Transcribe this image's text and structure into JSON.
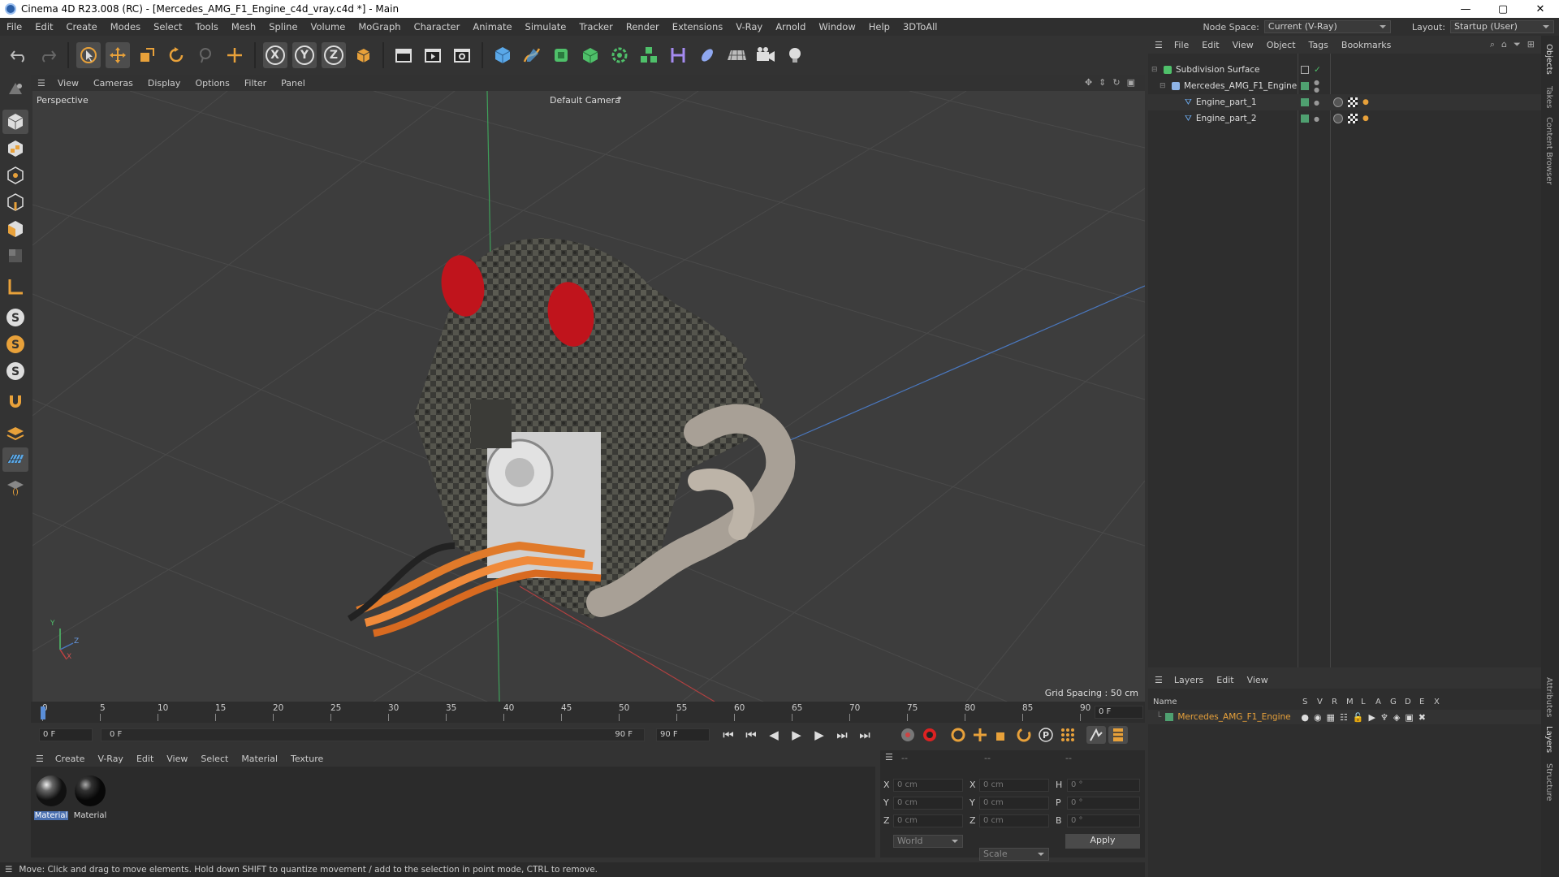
{
  "title": "Cinema 4D R23.008 (RC) - [Mercedes_AMG_F1_Engine_c4d_vray.c4d *] - Main",
  "window_buttons": [
    "—",
    "▢",
    "✕"
  ],
  "menu": [
    "File",
    "Edit",
    "Create",
    "Modes",
    "Select",
    "Tools",
    "Mesh",
    "Spline",
    "Volume",
    "MoGraph",
    "Character",
    "Animate",
    "Simulate",
    "Tracker",
    "Render",
    "Extensions",
    "V-Ray",
    "Arnold",
    "Window",
    "Help",
    "3DToAll"
  ],
  "node_space": {
    "label": "Node Space:",
    "value": "Current (V-Ray)"
  },
  "layout": {
    "label": "Layout:",
    "value": "Startup (User)"
  },
  "axis_buttons": [
    "X",
    "Y",
    "Z"
  ],
  "viewport_menu": [
    "View",
    "Cameras",
    "Display",
    "Options",
    "Filter",
    "Panel"
  ],
  "viewport": {
    "label": "Perspective",
    "camera": "Default Camera",
    "grid_spacing": "Grid Spacing : 50 cm"
  },
  "axis_gizmo": {
    "y": "Y",
    "z": "Z",
    "x": "X"
  },
  "timeline": {
    "ticks": [
      "0",
      "5",
      "10",
      "15",
      "20",
      "25",
      "30",
      "35",
      "40",
      "45",
      "50",
      "55",
      "60",
      "65",
      "70",
      "75",
      "80",
      "85",
      "90"
    ],
    "end_field": "0 F"
  },
  "transport": {
    "start": "0 F",
    "range_start": "0 F",
    "range_end": "90 F",
    "end": "90 F"
  },
  "material_menu": [
    "Create",
    "V-Ray",
    "Edit",
    "View",
    "Select",
    "Material",
    "Texture"
  ],
  "materials": [
    {
      "name": "Material"
    },
    {
      "name": "Material"
    }
  ],
  "coords": {
    "header": [
      "--",
      "--",
      "--"
    ],
    "rows": [
      {
        "a": "X",
        "av": "0 cm",
        "b": "X",
        "bv": "0 cm",
        "c": "H",
        "cv": "0 °"
      },
      {
        "a": "Y",
        "av": "0 cm",
        "b": "Y",
        "bv": "0 cm",
        "c": "P",
        "cv": "0 °"
      },
      {
        "a": "Z",
        "av": "0 cm",
        "b": "Z",
        "bv": "0 cm",
        "c": "B",
        "cv": "0 °"
      }
    ],
    "space": "World",
    "mode": "Scale",
    "apply": "Apply"
  },
  "status": "Move: Click and drag to move elements. Hold down SHIFT to quantize movement / add to the selection in point mode, CTRL to remove.",
  "object_menu": [
    "File",
    "Edit",
    "View",
    "Object",
    "Tags",
    "Bookmarks"
  ],
  "objects": [
    {
      "name": "Subdivision Surface",
      "indent": 0,
      "icon_color": "#4fc06a"
    },
    {
      "name": "Mercedes_AMG_F1_Engine",
      "indent": 1,
      "icon_color": "#8fb4e6"
    },
    {
      "name": "Engine_part_1",
      "indent": 2,
      "icon_color": "#6aa6e8"
    },
    {
      "name": "Engine_part_2",
      "indent": 2,
      "icon_color": "#6aa6e8"
    }
  ],
  "layer_menu": [
    "Layers",
    "Edit",
    "View"
  ],
  "layer_header": {
    "name": "Name",
    "cols": [
      "S",
      "V",
      "R",
      "M",
      "L",
      "A",
      "G",
      "D",
      "E",
      "X"
    ]
  },
  "layers": [
    {
      "name": "Mercedes_AMG_F1_Engine",
      "color": "#e8a13a"
    }
  ],
  "right_tabs": [
    "Objects",
    "Takes",
    "Content Browser",
    "Attributes",
    "Layers",
    "Structure"
  ]
}
